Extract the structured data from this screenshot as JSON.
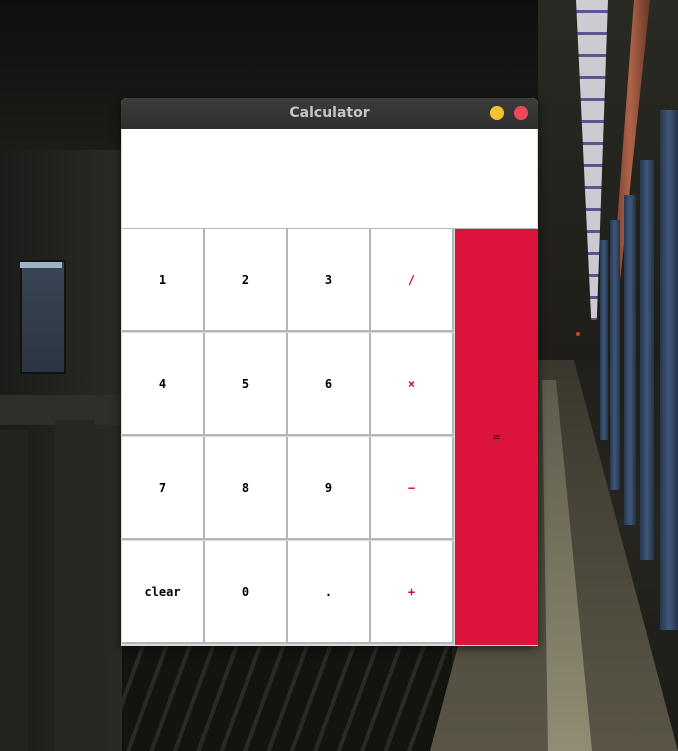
{
  "window": {
    "title": "Calculator"
  },
  "display": {
    "value": ""
  },
  "keys": {
    "row1": [
      "1",
      "2",
      "3",
      "/"
    ],
    "row2": [
      "4",
      "5",
      "6",
      "×"
    ],
    "row3": [
      "7",
      "8",
      "9",
      "−"
    ],
    "row4": [
      "clear",
      "0",
      ".",
      "+"
    ],
    "equals": "="
  },
  "colors": {
    "equals_bg": "#dc143c",
    "operator_text": "#c4143a",
    "minimize": "#f7c231",
    "close": "#f0485a",
    "titlebar": "#353535"
  }
}
